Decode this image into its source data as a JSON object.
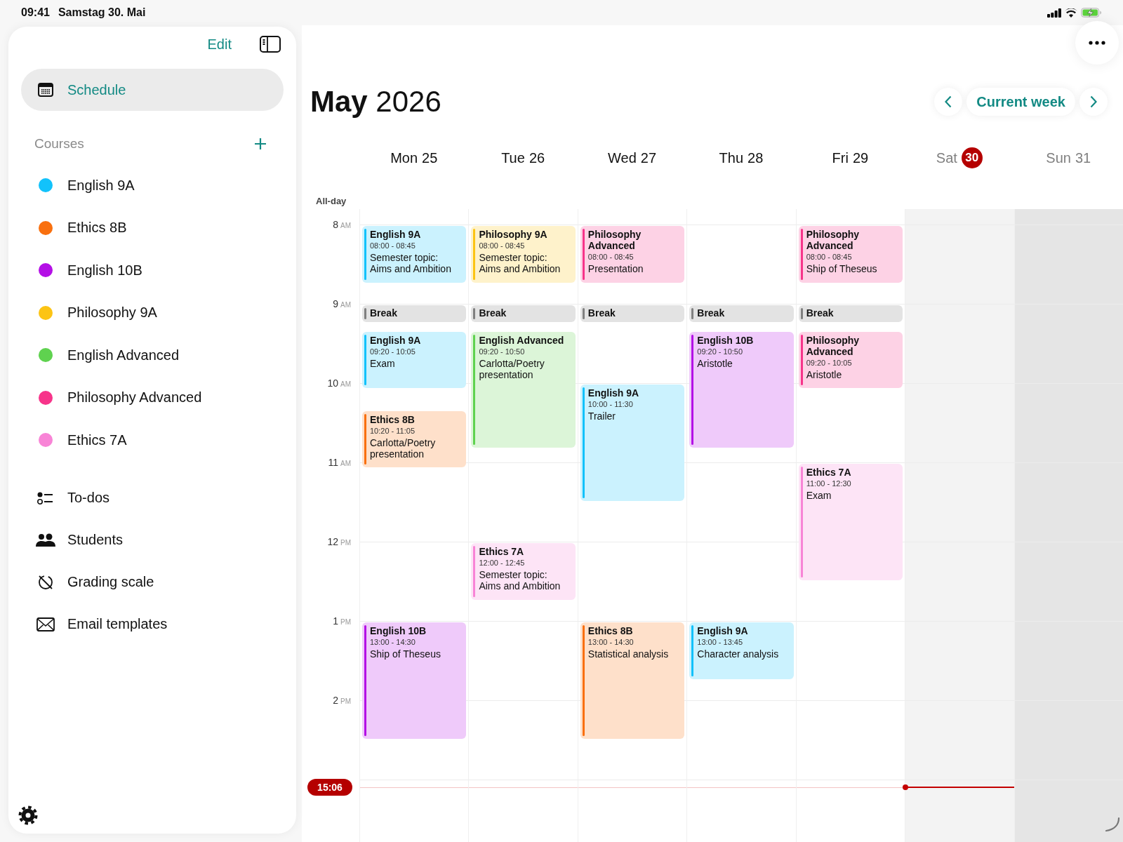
{
  "status_bar": {
    "time": "09:41",
    "date": "Samstag 30. Mai"
  },
  "sidebar": {
    "edit": "Edit",
    "top_items": [
      {
        "label": "Schedule",
        "kind": "calendar",
        "selected": true
      }
    ],
    "courses_header": "Courses",
    "courses": [
      {
        "label": "English 9A",
        "color": "#12c2fb"
      },
      {
        "label": "Ethics 8B",
        "color": "#f9700f"
      },
      {
        "label": "English 10B",
        "color": "#b40fe6"
      },
      {
        "label": "Philosophy 9A",
        "color": "#fcc414"
      },
      {
        "label": "English Advanced",
        "color": "#5fd24f"
      },
      {
        "label": "Philosophy Advanced",
        "color": "#f7348a"
      },
      {
        "label": "Ethics 7A",
        "color": "#f884d6"
      }
    ],
    "items": [
      {
        "label": "To-dos",
        "kind": "checklist",
        "selected": false
      },
      {
        "label": "Students",
        "kind": "people",
        "selected": false
      },
      {
        "label": "Grading scale",
        "kind": "grading",
        "selected": false
      },
      {
        "label": "Email templates",
        "kind": "mail",
        "selected": false
      }
    ]
  },
  "header": {
    "title": "**May** 2026",
    "current_week": "Current week"
  },
  "calendar": {
    "all_day_label": "All-day",
    "now": "15:06",
    "hours": [
      {
        "hour": "8",
        "period": "AM",
        "break": false
      },
      {
        "hour": "9",
        "period": "AM",
        "break": true
      },
      {
        "hour": "10",
        "period": "AM",
        "break": false
      },
      {
        "hour": "11",
        "period": "AM",
        "break": false
      },
      {
        "hour": "12",
        "period": "PM",
        "break": false
      },
      {
        "hour": "1",
        "period": "PM",
        "break": false
      },
      {
        "hour": "2",
        "period": "PM",
        "break": false
      }
    ],
    "days": [
      {
        "name": "Mon",
        "date": "25",
        "today": false,
        "weekend": false,
        "events": [
          {
            "kind": "lesson",
            "title": "English 9A",
            "time": "08:00 - 08:45",
            "note": "Semester topic: Aims and Ambition",
            "color": "#12c2fb"
          },
          {
            "kind": "break",
            "title": "Break",
            "color": "#808080"
          },
          {
            "kind": "lesson",
            "title": "English 9A",
            "time": "09:20 - 10:05",
            "note": "Exam",
            "color": "#12c2fb"
          },
          {
            "kind": "lesson",
            "title": "Ethics 8B",
            "time": "10:20 - 11:05",
            "note": "Carlotta/Poetry presentation",
            "color": "#f9700f"
          },
          {
            "kind": "lesson",
            "title": "English 10B",
            "time": "13:00 - 14:30",
            "note": "Ship of Theseus",
            "color": "#b40fe6"
          }
        ]
      },
      {
        "name": "Tue",
        "date": "26",
        "today": false,
        "weekend": false,
        "events": [
          {
            "kind": "lesson",
            "title": "Philosophy 9A",
            "time": "08:00 - 08:45",
            "note": "Semester topic: Aims and Ambition",
            "color": "#fcc414"
          },
          {
            "kind": "break",
            "title": "Break",
            "color": "#808080"
          },
          {
            "kind": "lesson",
            "title": "English Advanced",
            "time": "09:20 - 10:50",
            "note": "Carlotta/Poetry presentation",
            "color": "#5fd24f"
          },
          {
            "kind": "lesson",
            "title": "Ethics 7A",
            "time": "12:00 - 12:45",
            "note": "Semester topic: Aims and Ambition",
            "color": "#f884d6"
          }
        ]
      },
      {
        "name": "Wed",
        "date": "27",
        "today": false,
        "weekend": false,
        "events": [
          {
            "kind": "lesson",
            "title": "Philosophy Advanced",
            "time": "08:00 - 08:45",
            "note": "Presentation",
            "color": "#f7348a"
          },
          {
            "kind": "break",
            "title": "Break",
            "color": "#808080"
          },
          {
            "kind": "lesson",
            "title": "English 9A",
            "time": "10:00 - 11:30",
            "note": "Trailer",
            "color": "#12c2fb"
          },
          {
            "kind": "lesson",
            "title": "Ethics 8B",
            "time": "13:00 - 14:30",
            "note": "Statistical analysis",
            "color": "#f9700f"
          }
        ]
      },
      {
        "name": "Thu",
        "date": "28",
        "today": false,
        "weekend": false,
        "events": [
          {
            "kind": "break",
            "title": "Break",
            "color": "#808080"
          },
          {
            "kind": "lesson",
            "title": "English 10B",
            "time": "09:20 - 10:50",
            "note": "Aristotle",
            "color": "#b40fe6"
          },
          {
            "kind": "lesson",
            "title": "English 9A",
            "time": "13:00 - 13:45",
            "note": "Character analysis",
            "color": "#12c2fb"
          }
        ]
      },
      {
        "name": "Fri",
        "date": "29",
        "today": false,
        "weekend": false,
        "events": [
          {
            "kind": "lesson",
            "title": "Philosophy Advanced",
            "time": "08:00 - 08:45",
            "note": "Ship of Theseus",
            "color": "#f7348a"
          },
          {
            "kind": "break",
            "title": "Break",
            "color": "#808080"
          },
          {
            "kind": "lesson",
            "title": "Philosophy Advanced",
            "time": "09:20 - 10:05",
            "note": "Aristotle",
            "color": "#f7348a"
          },
          {
            "kind": "lesson",
            "title": "Ethics 7A",
            "time": "11:00 - 12:30",
            "note": "Exam",
            "color": "#f884d6"
          }
        ]
      },
      {
        "name": "Sat",
        "date": "30",
        "today": true,
        "weekend": true
      },
      {
        "name": "Sun",
        "date": "31",
        "today": false,
        "weekend": true
      }
    ]
  }
}
